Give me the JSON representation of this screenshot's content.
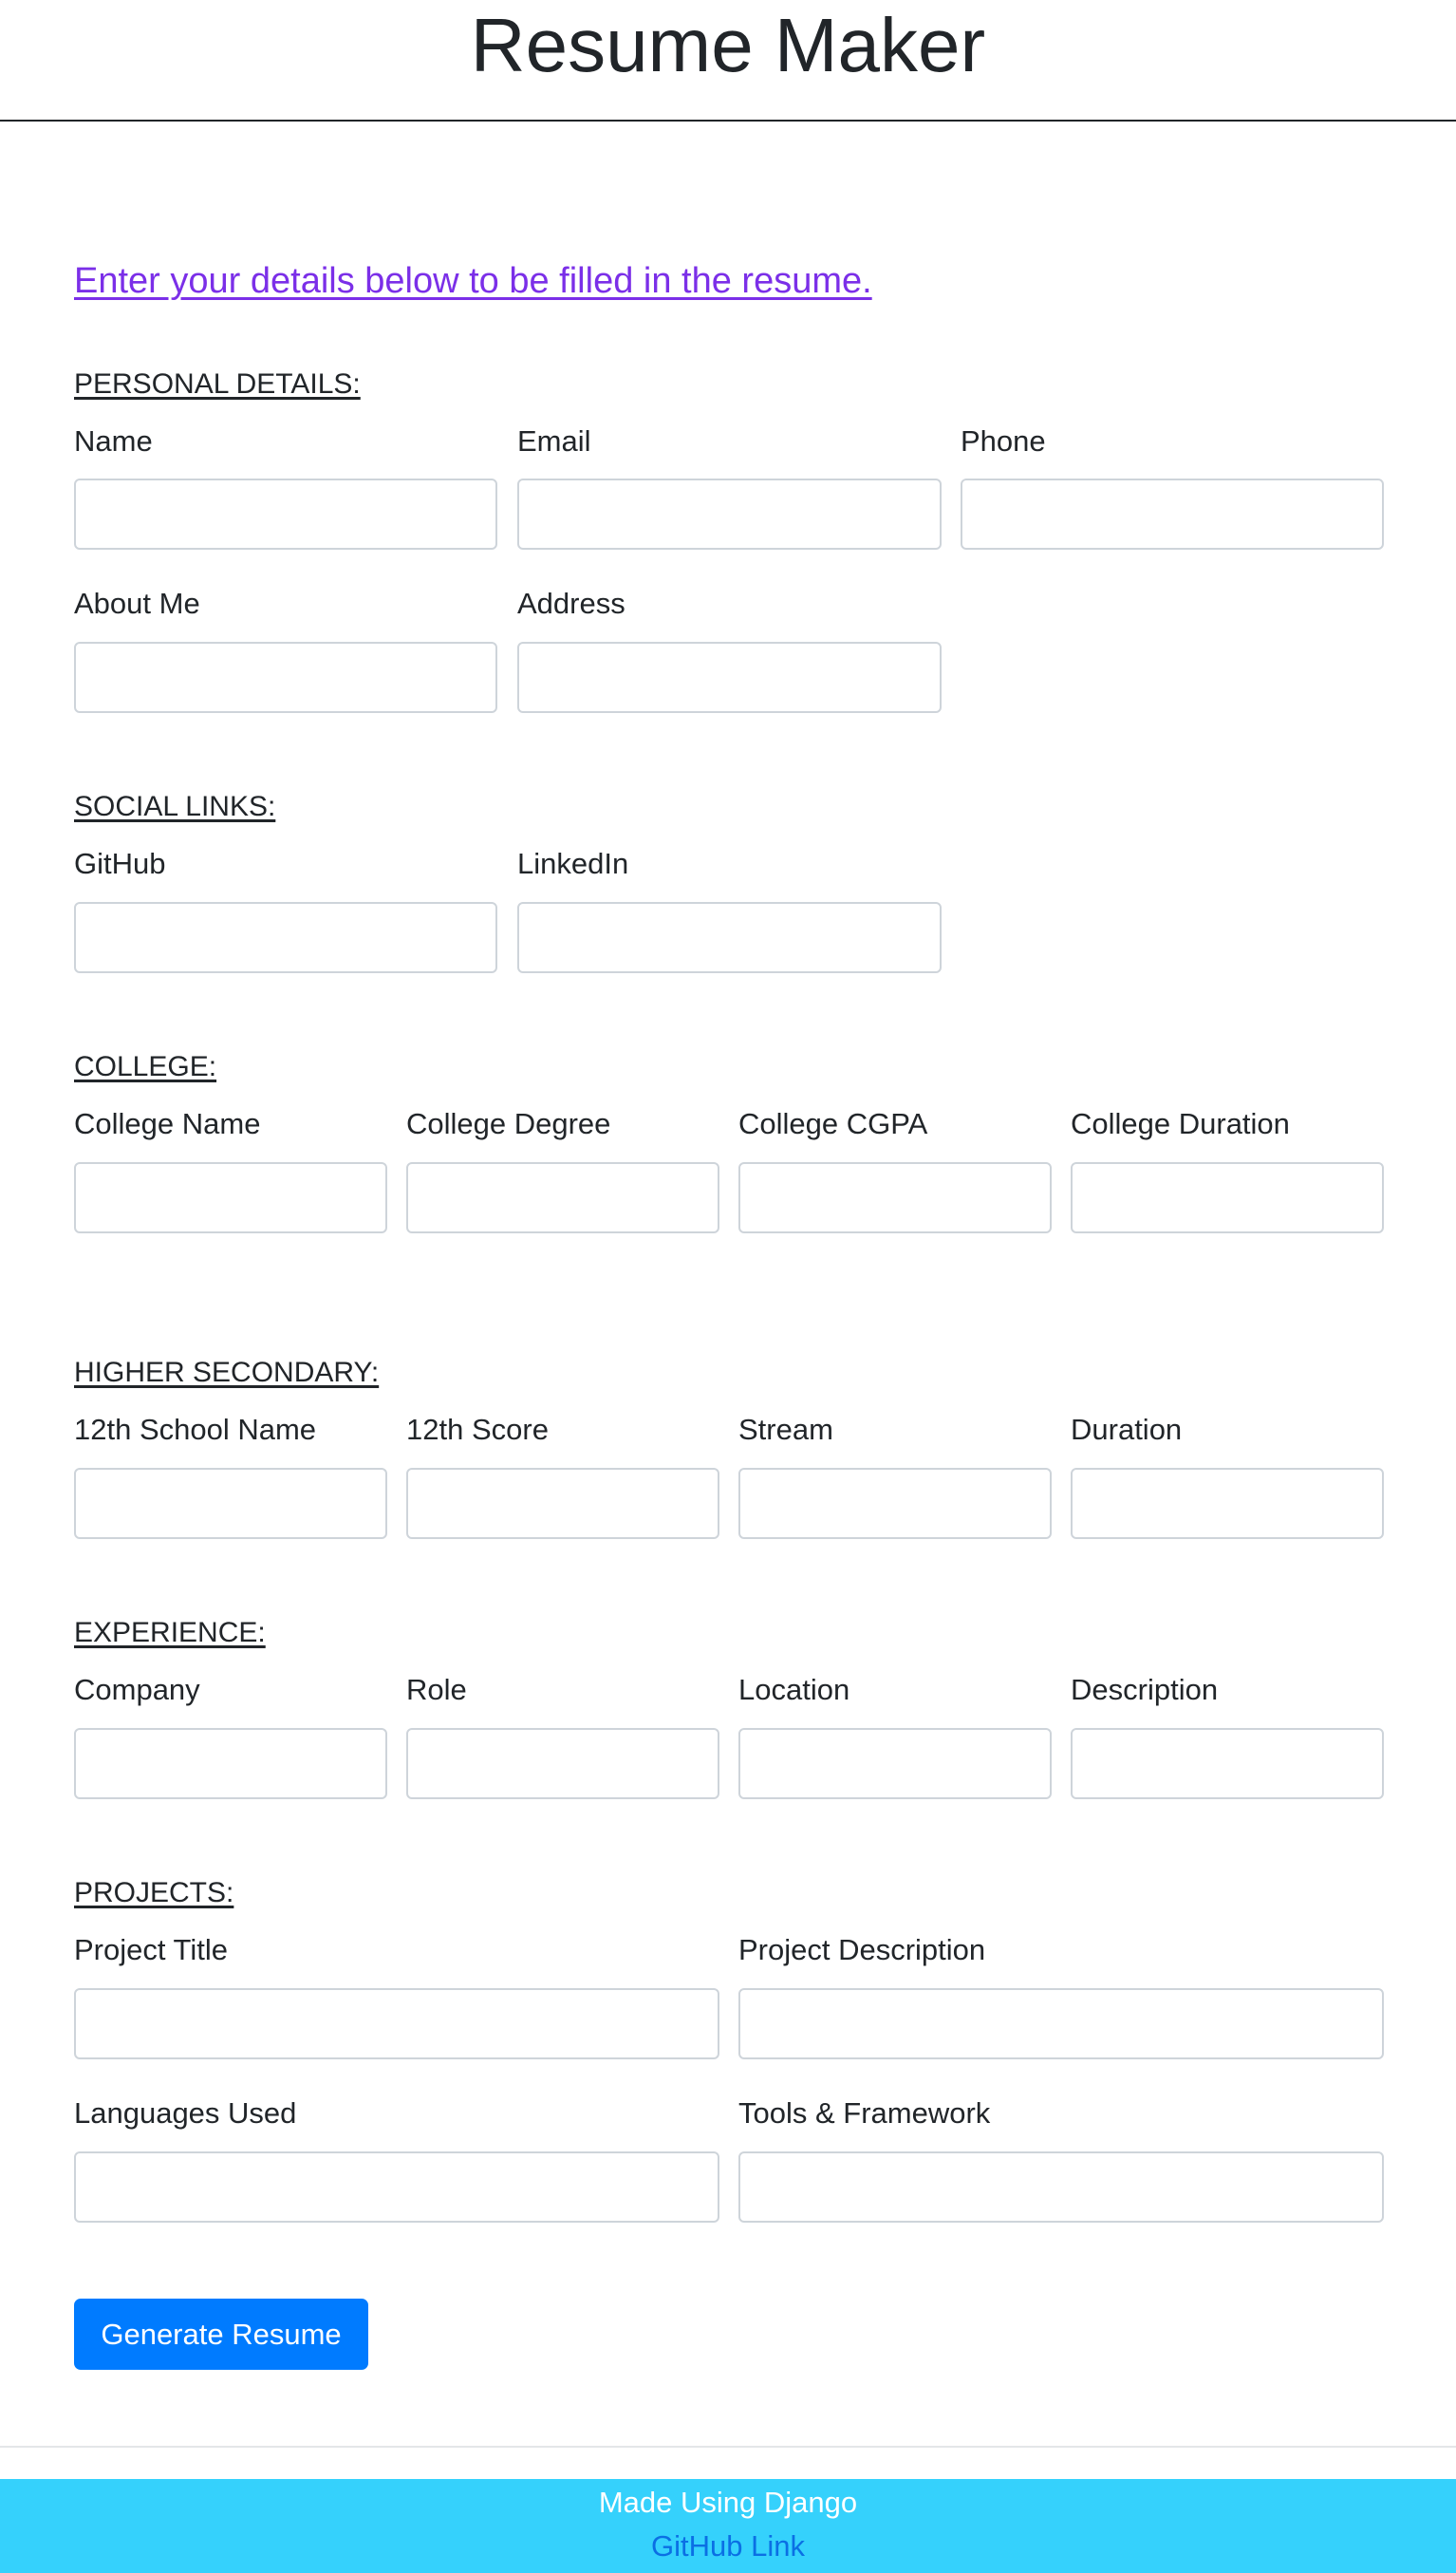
{
  "header": {
    "title": "Resume Maker"
  },
  "intro": {
    "text": "Enter your details below to be filled in the resume."
  },
  "sections": {
    "personal": {
      "title": "PERSONAL DETAILS:",
      "fields": {
        "name": {
          "label": "Name",
          "value": ""
        },
        "email": {
          "label": "Email",
          "value": ""
        },
        "phone": {
          "label": "Phone",
          "value": ""
        },
        "about": {
          "label": "About Me",
          "value": ""
        },
        "address": {
          "label": "Address",
          "value": ""
        }
      }
    },
    "social": {
      "title": "SOCIAL LINKS:",
      "fields": {
        "github": {
          "label": "GitHub",
          "value": ""
        },
        "linkedin": {
          "label": "LinkedIn",
          "value": ""
        }
      }
    },
    "college": {
      "title": "COLLEGE:",
      "fields": {
        "name": {
          "label": "College Name",
          "value": ""
        },
        "degree": {
          "label": "College Degree",
          "value": ""
        },
        "cgpa": {
          "label": "College CGPA",
          "value": ""
        },
        "duration": {
          "label": "College Duration",
          "value": ""
        }
      }
    },
    "higher_secondary": {
      "title": "HIGHER SECONDARY:",
      "fields": {
        "school": {
          "label": "12th School Name",
          "value": ""
        },
        "score": {
          "label": "12th Score",
          "value": ""
        },
        "stream": {
          "label": "Stream",
          "value": ""
        },
        "duration": {
          "label": "Duration",
          "value": ""
        }
      }
    },
    "experience": {
      "title": "EXPERIENCE:",
      "fields": {
        "company": {
          "label": "Company",
          "value": ""
        },
        "role": {
          "label": "Role",
          "value": ""
        },
        "location": {
          "label": "Location",
          "value": ""
        },
        "description": {
          "label": "Description",
          "value": ""
        }
      }
    },
    "projects": {
      "title": "PROJECTS:",
      "fields": {
        "title": {
          "label": "Project Title",
          "value": ""
        },
        "description": {
          "label": "Project Description",
          "value": ""
        },
        "languages": {
          "label": "Languages Used",
          "value": ""
        },
        "tools": {
          "label": "Tools & Framework",
          "value": ""
        }
      }
    }
  },
  "form": {
    "submit_label": "Generate Resume"
  },
  "footer": {
    "text": "Made Using Django",
    "link_label": "GitHub Link"
  },
  "colors": {
    "primary_button": "#007bff",
    "intro_link": "#7b2fe8",
    "footer_background": "#35d1fc",
    "footer_link": "#0b6fe4",
    "input_border": "#ced4da"
  }
}
